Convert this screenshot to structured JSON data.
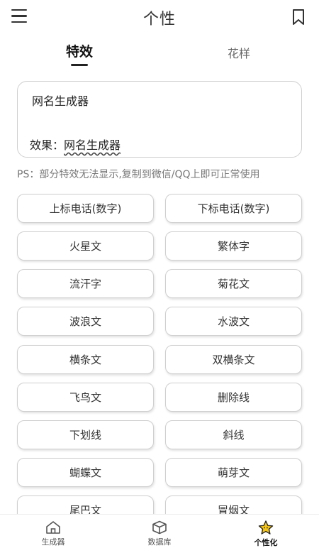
{
  "header": {
    "title": "个性"
  },
  "tabs": [
    {
      "label": "特效"
    },
    {
      "label": "花样"
    }
  ],
  "editor": {
    "input_value": "网名生成器",
    "result_label": "效果：",
    "result_value": "网名生成器"
  },
  "note": "PS：部分特效无法显示,复制到微信/QQ上即可正常使用",
  "effects": [
    "上标电话(数字)",
    "下标电话(数字)",
    "火星文",
    "繁体字",
    "流汗字",
    "菊花文",
    "波浪文",
    "水波文",
    "横条文",
    "双横条文",
    "飞鸟文",
    "删除线",
    "下划线",
    "斜线",
    "蝴蝶文",
    "萌芽文",
    "尾巴文",
    "冒烟文"
  ],
  "bottom_nav": [
    {
      "label": "生成器",
      "icon": "home-icon"
    },
    {
      "label": "数据库",
      "icon": "box-icon"
    },
    {
      "label": "个性化",
      "icon": "star-icon",
      "active": true
    }
  ],
  "colors": {
    "accent_star": "#f5c518",
    "text_dark": "#222222",
    "border": "#cfcfcf"
  }
}
